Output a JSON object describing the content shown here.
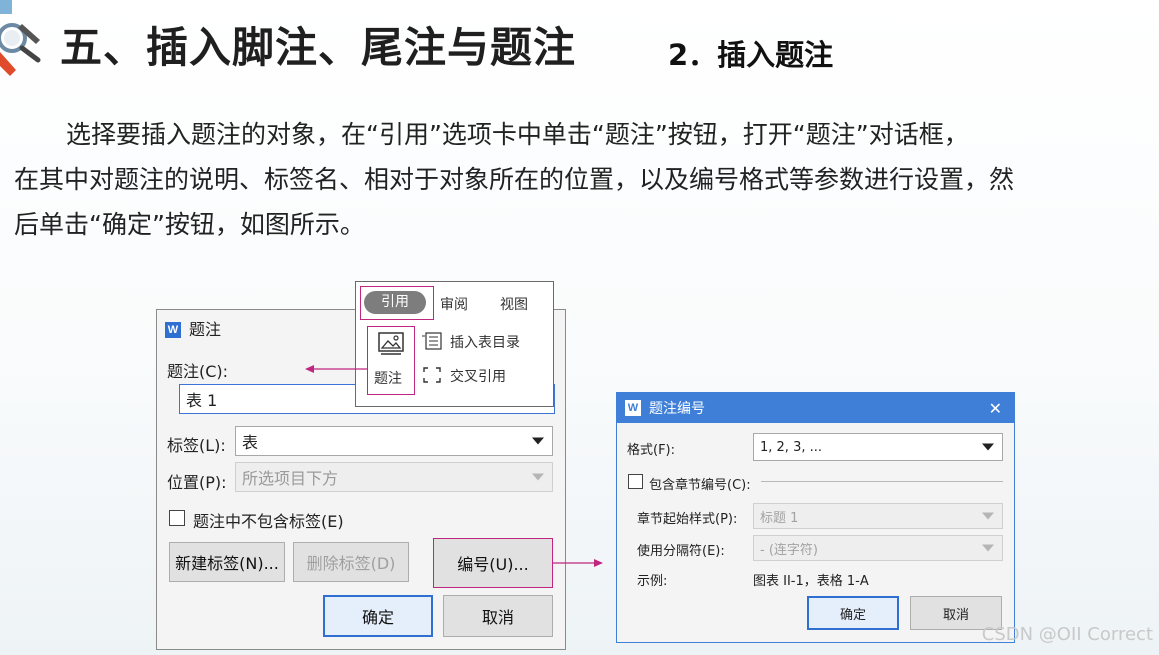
{
  "header": {
    "title": "五、插入脚注、尾注与题注",
    "subtitle": "2．插入题注"
  },
  "paragraph": {
    "line1": "选择要插入题注的对象，在“引用”选项卡中单击“题注”按钮，打开“题注”对话框，",
    "line2": "在其中对题注的说明、标签名、相对于对象所在的位置，以及编号格式等参数进行设置，然",
    "line3": "后单击“确定”按钮，如图所示。"
  },
  "caption_dialog": {
    "app_logo": "W",
    "title": "题注",
    "caption_label": "题注(C):",
    "caption_value": "表 1",
    "tag_label": "标签(L):",
    "tag_value": "表",
    "position_label": "位置(P):",
    "position_value": "所选项目下方",
    "exclude_label_checkbox": "题注中不包含标签(E)",
    "new_label_button": "新建标签(N)...",
    "delete_label_button": "删除标签(D)",
    "numbering_button": "编号(U)...",
    "ok_button": "确定",
    "cancel_button": "取消"
  },
  "ribbon": {
    "tabs": [
      "引用",
      "审阅",
      "视图"
    ],
    "caption_button": "题注",
    "insert_toc_button": "插入表目录",
    "cross_ref_button": "交叉引用"
  },
  "numbering_dialog": {
    "app_logo": "W",
    "title": "题注编号",
    "close": "✕",
    "format_label": "格式(F):",
    "format_value": "1, 2, 3, ...",
    "include_chapter_checkbox": "包含章节编号(C):",
    "chapter_style_label": "章节起始样式(P):",
    "chapter_style_value": "标题 1",
    "separator_label": "使用分隔符(E):",
    "separator_value": "- (连字符)",
    "example_label": "示例:",
    "example_value": "图表 II-1，表格 1-A",
    "ok_button": "确定",
    "cancel_button": "取消"
  },
  "watermark": "CSDN @OII Correct",
  "colors": {
    "accent_blue": "#3f7fd8",
    "highlight_magenta": "#c0267f"
  }
}
